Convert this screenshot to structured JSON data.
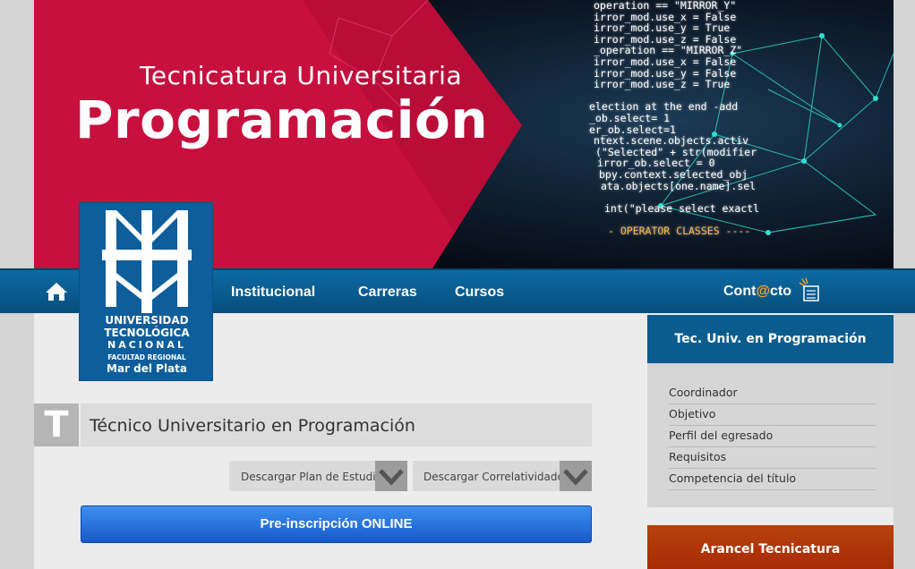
{
  "banner": {
    "subtitle": "Tecnicatura Universitaria",
    "title": "Programación",
    "code_lines": [
      "operation == \"MIRROR_Y\"",
      "irror_mod.use_x = False",
      "irror_mod.use_y = True",
      "irror_mod.use_z = False",
      "_operation == \"MIRROR_Z\"",
      "irror_mod.use_x = False",
      "irror_mod.use_y = False",
      "irror_mod.use_z = True",
      "",
      "election at the end -add",
      "_ob.select= 1",
      "er_ob.select=1",
      "ntext.scene.objects.activ",
      "(\"Selected\" + str(modifier",
      "irror_ob.select = 0",
      "bpy.context.selected_obj",
      "ata.objects[one.name].sel",
      "",
      "int(\"please select exactl",
      "",
      "- OPERATOR CLASSES ----"
    ]
  },
  "nav": {
    "home_icon": "home-icon",
    "items": [
      "Institucional",
      "Carreras",
      "Cursos"
    ],
    "contact_pre": "Cont",
    "contact_at": "@",
    "contact_post": "cto"
  },
  "logo": {
    "line1": "UNIVERSIDAD",
    "line2": "TECNOLÓGICA",
    "line3": "NACIONAL",
    "line4": "FACULTAD REGIONAL",
    "line5": "Mar del Plata"
  },
  "title": {
    "letter": "T",
    "text": "Técnico Universitario en Programación"
  },
  "downloads": {
    "plan": "Descargar Plan de Estudio",
    "correlatividades": "Descargar Correlatividades"
  },
  "preinscripcion": "Pre-inscripción ONLINE",
  "sidebar": {
    "heading": "Tec. Univ. en Programación",
    "items": [
      "Coordinador",
      "Objetivo",
      "Perfil del egresado",
      "Requisitos",
      "Competencia del título"
    ],
    "arancel": "Arancel Tecnicatura"
  },
  "colors": {
    "nav_blue": "#0a5c8f",
    "banner_red": "#c8103e",
    "preinscripcion_blue": "#1f6fdc",
    "arancel_orange": "#b8420c"
  }
}
